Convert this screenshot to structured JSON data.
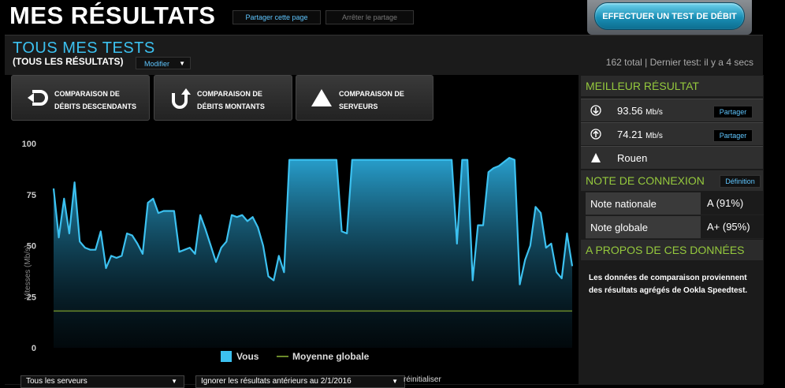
{
  "header": {
    "title": "MES RÉSULTATS",
    "share_page": "Partager cette page",
    "stop_share": "Arrêter le partage",
    "cta": "EFFECTUER UN TEST DE DÉBIT"
  },
  "panel": {
    "title": "TOUS MES TESTS",
    "subtitle": "(TOUS LES RÉSULTATS)",
    "modify": "Modifier",
    "summary": "162 total | Dernier test: il y a 4 secs"
  },
  "tabs": [
    {
      "line1": "COMPARAISON DE",
      "line2": "DÉBITS DESCENDANTS",
      "icon": "download-arrow-icon"
    },
    {
      "line1": "COMPARAISON DE",
      "line2": "DÉBITS MONTANTS",
      "icon": "upload-arrow-icon"
    },
    {
      "line1": "COMPARAISON DE",
      "line2": "SERVEURS",
      "icon": "triangle-icon"
    }
  ],
  "best": {
    "header": "MEILLEUR RÉSULTAT",
    "download": "93.56",
    "download_unit": "Mb/s",
    "upload": "74.21",
    "upload_unit": "Mb/s",
    "server": "Rouen",
    "share": "Partager"
  },
  "grade": {
    "header": "NOTE DE CONNEXION",
    "definition": "Définition",
    "national_label": "Note nationale",
    "national_value": "A (91%)",
    "global_label": "Note globale",
    "global_value": "A+ (95%)"
  },
  "about": {
    "header": "A PROPOS DE CES DONNÉES",
    "text": "Les données de comparaison proviennent des résultats agrégés de Ookla Speedtest."
  },
  "filters": {
    "servers": "Tous les serveurs",
    "ignore": "Ignorer les résultats antérieurs au 2/1/2016",
    "reset": "réinitialiser"
  },
  "colors": {
    "accent_blue": "#3cc1f0",
    "accent_green": "#95c93d",
    "average_line": "#6b8a2a"
  },
  "chart_data": {
    "type": "area",
    "ylabel": "Vitesses (Mb/s)",
    "ylim": [
      0,
      100
    ],
    "yticks": [
      0,
      25,
      50,
      75,
      100
    ],
    "grid": false,
    "legend": [
      "Vous",
      "Moyenne globale"
    ],
    "average": 18,
    "series": [
      {
        "name": "Vous",
        "values": [
          78,
          54,
          73,
          56,
          81,
          52,
          49,
          48,
          48,
          57,
          39,
          45,
          44,
          45,
          56,
          55,
          51,
          46,
          71,
          73,
          66,
          67,
          67,
          67,
          47,
          48,
          49,
          46,
          65,
          58,
          50,
          42,
          49,
          52,
          65,
          64,
          65,
          62,
          64,
          59,
          50,
          35,
          33,
          45,
          37,
          92,
          92,
          92,
          92,
          92,
          92,
          92,
          92,
          92,
          92,
          57,
          56,
          92,
          92,
          92,
          92,
          92,
          92,
          92,
          92,
          92,
          92,
          92,
          92,
          92,
          92,
          92,
          92,
          92,
          92,
          92,
          92,
          51,
          92,
          92,
          33,
          60,
          60,
          86,
          88,
          89,
          91,
          93,
          92,
          31,
          43,
          50,
          69,
          66,
          49,
          51,
          37,
          34,
          56,
          40
        ]
      }
    ]
  }
}
